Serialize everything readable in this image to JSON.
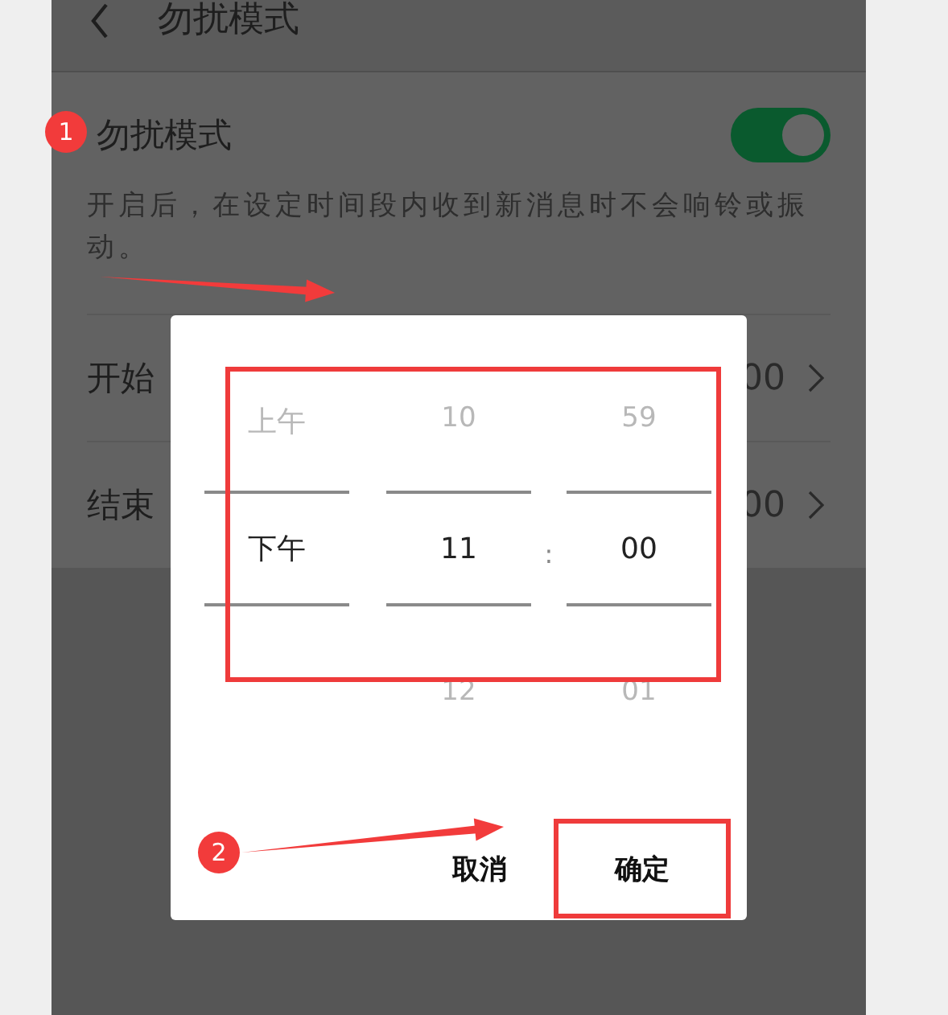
{
  "header": {
    "title": "勿扰模式"
  },
  "dnd": {
    "label": "勿扰模式",
    "on": true,
    "description": "开启后，在设定时间段内收到新消息时不会响铃或振动。"
  },
  "time_rows": [
    {
      "label": "开始",
      "value": "00"
    },
    {
      "label": "结束",
      "value": "00"
    }
  ],
  "dialog": {
    "picker_marked": true,
    "separator": ":",
    "columns": [
      {
        "kind": "ampm",
        "above": "上午",
        "selected": "下午"
      },
      {
        "kind": "hour",
        "above": "10",
        "selected": "11",
        "below": "12"
      },
      {
        "kind": "minute",
        "above": "59",
        "selected": "00",
        "below": "01"
      }
    ],
    "buttons": [
      {
        "label": "取消",
        "marked": false
      },
      {
        "label": "确定",
        "marked": true
      }
    ]
  },
  "annotations": [
    {
      "kind": "badge",
      "text": "1"
    },
    {
      "kind": "badge",
      "text": "2"
    }
  ]
}
